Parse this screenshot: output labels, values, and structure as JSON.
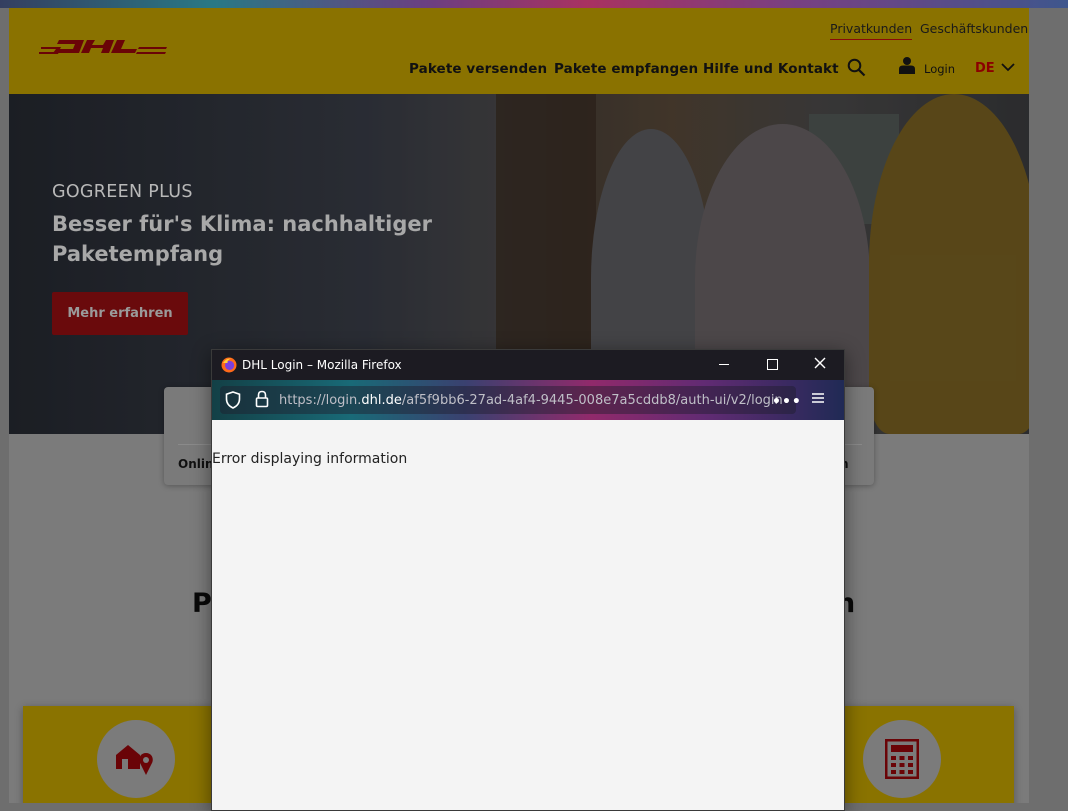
{
  "header": {
    "top_links": [
      "Privatkunden",
      "Geschäftskunden"
    ],
    "nav_items": [
      "Pakete versenden",
      "Pakete empfangen",
      "Hilfe und Kontakt"
    ],
    "login_label": "Login",
    "language": "DE"
  },
  "hero": {
    "eyebrow": "GOGREEN PLUS",
    "title": "Besser für's Klima: nachhaltiger Paketempfang",
    "button": "Mehr erfahren"
  },
  "widget": {
    "left_label_partial": "Onlin",
    "right_label_partial": "n"
  },
  "section": {
    "heading_left_partial": "P",
    "heading_right_partial": "n"
  },
  "firefox": {
    "window_title": "DHL Login – Mozilla Firefox",
    "url_prefix": "https://login.",
    "url_domain": "dhl.de",
    "url_path": "/af5f9bb6-27ad-4af4-9445-008e7a5cddb8/auth-ui/v2/login",
    "more_label": "•••",
    "error_message": "Error displaying information"
  },
  "colors": {
    "dhl_yellow": "#FFCC00",
    "dhl_red": "#D40511",
    "firefox_titlebar": "#1C1B22"
  },
  "icons": [
    "dhl-logo",
    "search-icon",
    "user-icon",
    "chevron-down-icon",
    "house-location-icon",
    "calculator-icon",
    "firefox-logo",
    "shield-icon",
    "lock-icon",
    "menu-icon",
    "close-icon"
  ]
}
